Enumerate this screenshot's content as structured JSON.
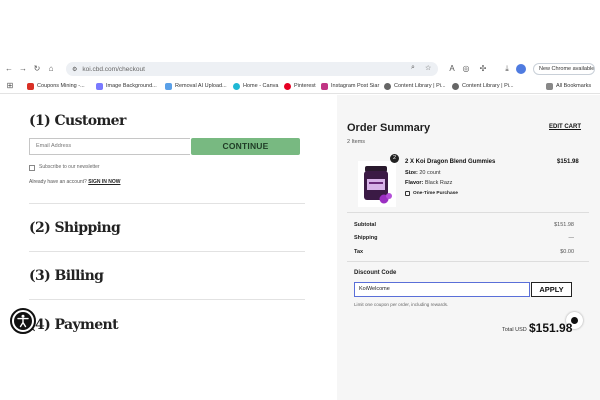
{
  "browser": {
    "url": "koi.cbd.com/checkout",
    "new_chrome_label": "New Chrome available",
    "bookmarks": [
      {
        "label": "Coupons Mining -...",
        "color": "#d93025"
      },
      {
        "label": "Image Background...",
        "color": "#7a7aff"
      },
      {
        "label": "Removal AI Upload...",
        "color": "#5aa0e8"
      },
      {
        "label": "Home - Canva",
        "color": "#1fb8d4"
      },
      {
        "label": "Pinterest",
        "color": "#e60023"
      },
      {
        "label": "Instagram Post Siar",
        "color": "#c13584"
      },
      {
        "label": "Content Library | Pi...",
        "color": "#666666"
      },
      {
        "label": "Content Library | Pi...",
        "color": "#666666"
      },
      {
        "label": "All Bookmarks",
        "color": "#888888"
      }
    ]
  },
  "checkout": {
    "customer": {
      "title": "(1) Customer",
      "email_placeholder": "Email Address",
      "continue_label": "CONTINUE",
      "newsletter_label": "Subscribe to our newsletter",
      "account_prompt": "Already have an account?",
      "sign_in_label": "SIGN IN NOW"
    },
    "shipping_title": "(2) Shipping",
    "billing_title": "(3) Billing",
    "payment_title": "(4) Payment"
  },
  "order_summary": {
    "title": "Order Summary",
    "edit_cart_label": "EDIT CART",
    "items_count": "2 Items",
    "product": {
      "qty": "2",
      "name": "2 X Koi Dragon Blend Gummies",
      "price": "$151.98",
      "size_label": "Size:",
      "size_value": "20 count",
      "flavor_label": "Flavor:",
      "flavor_value": "Black Razz",
      "purchase_type": "One-Time Purchase"
    },
    "subtotal_label": "Subtotal",
    "subtotal_value": "$151.98",
    "shipping_label": "Shipping",
    "shipping_value": "—",
    "tax_label": "Tax",
    "tax_value": "$0.00",
    "discount_label": "Discount Code",
    "discount_value": "KoiWelcome",
    "apply_label": "APPLY",
    "limit_note": "Limit one coupon per order, including rewards.",
    "total_label": "Total USD",
    "total_value": "$151.98"
  }
}
